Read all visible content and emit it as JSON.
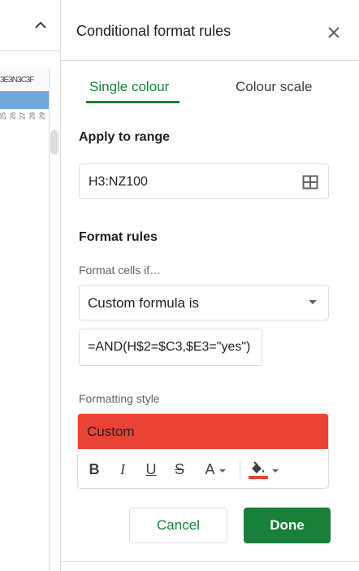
{
  "sheet": {
    "column_header_text": "3E3N3C3F",
    "row_numbers": [
      "25",
      "26",
      "27",
      "28",
      "29"
    ]
  },
  "panel": {
    "title": "Conditional format rules",
    "tabs": [
      {
        "label": "Single colour",
        "active": true
      },
      {
        "label": "Colour scale",
        "active": false
      }
    ],
    "apply_to_range": {
      "label": "Apply to range",
      "value": "H3:NZ100"
    },
    "format_rules": {
      "label": "Format rules",
      "condition_label": "Format cells if…",
      "condition_value": "Custom formula is",
      "formula_value": "=AND(H$2=$C3,$E3=\"yes\")"
    },
    "formatting_style": {
      "label": "Formatting style",
      "preview_text": "Custom",
      "fill_color": "#ea4335",
      "toolbar": [
        "bold-icon",
        "italic-icon",
        "underline-icon",
        "strikethrough-icon",
        "text-colour-icon",
        "fill-colour-icon"
      ]
    },
    "buttons": {
      "cancel": "Cancel",
      "done": "Done"
    }
  },
  "colors": {
    "accent": "#188038",
    "range_highlight": "#6fa8dc"
  }
}
